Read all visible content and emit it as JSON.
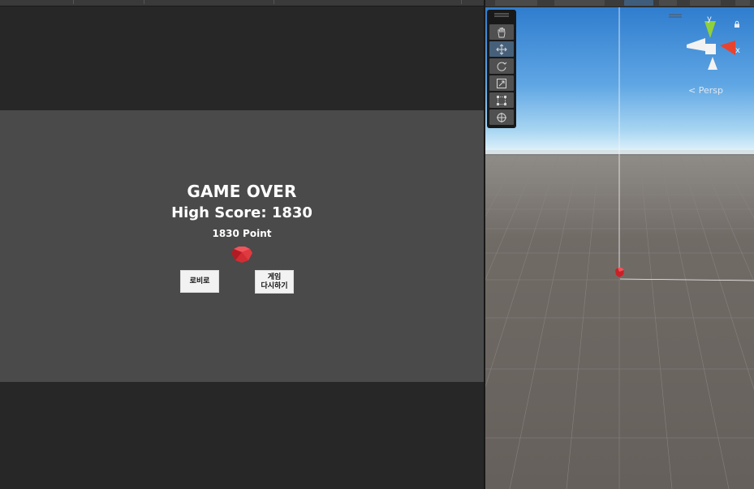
{
  "game": {
    "title": "GAME OVER",
    "high_score": "High Score: 1830",
    "points": "1830 Point",
    "lobby_button": "로비로",
    "restart_line1": "게임",
    "restart_line2": "다시하기"
  },
  "scene": {
    "camera_mode": "< Persp",
    "axis_y": "y",
    "axis_x": "x",
    "tools": [
      "hand-tool",
      "move-tool",
      "rotate-tool",
      "scale-tool",
      "rect-tool",
      "transform-tool"
    ],
    "active_tool": "move-tool"
  },
  "colors": {
    "game_background": "#4a4a4a",
    "gem": "#d8323a",
    "sky_top": "#2f7fd0",
    "ground": "#6b6560",
    "axis_x": "#e8432f",
    "axis_y": "#8fd13a"
  }
}
